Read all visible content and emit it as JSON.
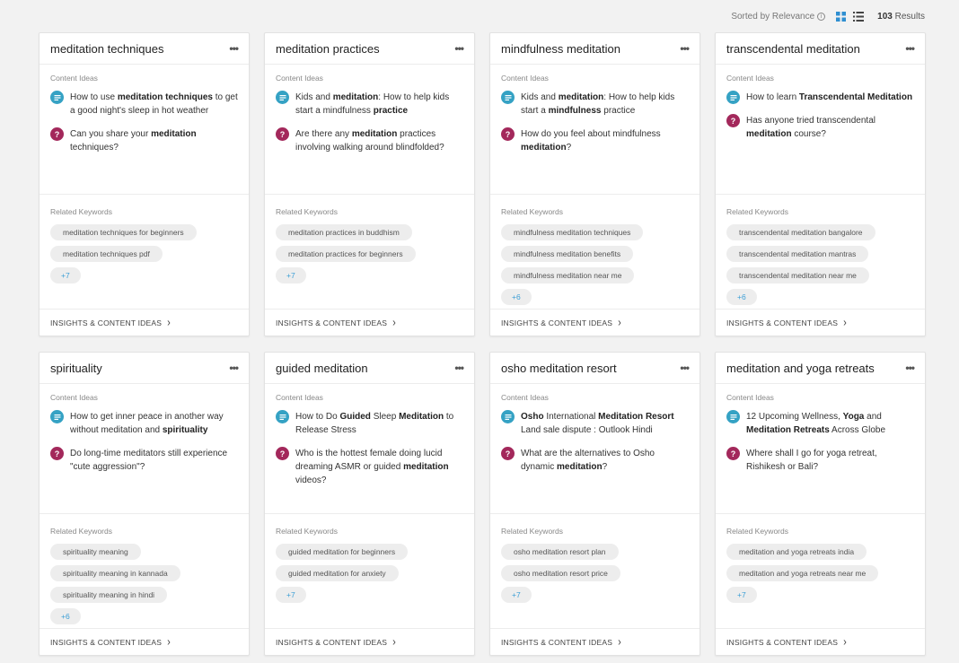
{
  "toolbar": {
    "sort_label": "Sorted by Relevance",
    "results_count": "103",
    "results_label": "Results",
    "accent_color": "#2f8fd1"
  },
  "labels": {
    "content_ideas": "Content Ideas",
    "related_keywords": "Related Keywords",
    "footer_link": "INSIGHTS & CONTENT IDEAS"
  },
  "cards": [
    {
      "title": "meditation techniques",
      "ideas": [
        {
          "type": "article",
          "html": "How to use <b>meditation techniques</b> to get a good night's sleep in hot weather"
        },
        {
          "type": "question",
          "html": "Can you share your <b>meditation</b> techniques?"
        }
      ],
      "keywords": [
        "meditation techniques for beginners",
        "meditation techniques pdf"
      ],
      "more": "+7"
    },
    {
      "title": "meditation practices",
      "ideas": [
        {
          "type": "article",
          "html": "Kids and <b>meditation</b>: How to help kids start a mindfulness <b>practice</b>"
        },
        {
          "type": "question",
          "html": "Are there any <b>meditation</b> practices involving walking around blindfolded?"
        }
      ],
      "keywords": [
        "meditation practices in buddhism",
        "meditation practices for beginners"
      ],
      "more": "+7"
    },
    {
      "title": "mindfulness meditation",
      "ideas": [
        {
          "type": "article",
          "html": "Kids and <b>meditation</b>: How to help kids start a <b>mindfulness</b> practice"
        },
        {
          "type": "question",
          "html": "How do you feel about mindfulness <b>meditation</b>?"
        }
      ],
      "keywords": [
        "mindfulness meditation techniques",
        "mindfulness meditation benefits",
        "mindfulness meditation near me"
      ],
      "more": "+6"
    },
    {
      "title": "transcendental meditation",
      "ideas": [
        {
          "type": "article",
          "html": "How to learn <b>Transcendental Meditation</b>"
        },
        {
          "type": "question",
          "html": "Has anyone tried transcendental <b>meditation</b> course?"
        }
      ],
      "keywords": [
        "transcendental meditation bangalore",
        "transcendental meditation mantras",
        "transcendental meditation near me"
      ],
      "more": "+6"
    },
    {
      "title": "spirituality",
      "ideas": [
        {
          "type": "article",
          "html": "How to get inner peace in another way without meditation and <b>spirituality</b>"
        },
        {
          "type": "question",
          "html": "Do long-time meditators still experience \"cute aggression\"?"
        }
      ],
      "keywords": [
        "spirituality meaning",
        "spirituality meaning in kannada",
        "spirituality meaning in hindi"
      ],
      "more": "+6"
    },
    {
      "title": "guided meditation",
      "ideas": [
        {
          "type": "article",
          "html": "How to Do <b>Guided</b> Sleep <b>Meditation</b> to Release Stress"
        },
        {
          "type": "question",
          "html": "Who is the hottest female doing lucid dreaming ASMR or guided <b>meditation</b> videos?"
        }
      ],
      "keywords": [
        "guided meditation for beginners",
        "guided meditation for anxiety"
      ],
      "more": "+7"
    },
    {
      "title": "osho meditation resort",
      "ideas": [
        {
          "type": "article",
          "html": "<b>Osho</b> International <b>Meditation Resort</b> Land sale dispute : Outlook Hindi"
        },
        {
          "type": "question",
          "html": "What are the alternatives to Osho dynamic <b>meditation</b>?"
        }
      ],
      "keywords": [
        "osho meditation resort plan",
        "osho meditation resort price"
      ],
      "more": "+7"
    },
    {
      "title": "meditation and yoga retreats",
      "ideas": [
        {
          "type": "article",
          "html": "12 Upcoming Wellness, <b>Yoga</b> and <b>Meditation Retreats</b> Across Globe"
        },
        {
          "type": "question",
          "html": "Where shall I go for yoga retreat, Rishikesh or Bali?"
        }
      ],
      "keywords": [
        "meditation and yoga retreats india",
        "meditation and yoga retreats near me"
      ],
      "more": "+7"
    }
  ]
}
